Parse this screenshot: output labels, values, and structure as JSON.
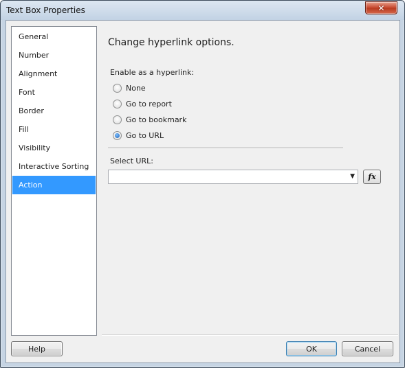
{
  "window": {
    "title": "Text Box Properties",
    "close_symbol": "✕"
  },
  "sidebar": {
    "items": [
      {
        "label": "General",
        "selected": false
      },
      {
        "label": "Number",
        "selected": false
      },
      {
        "label": "Alignment",
        "selected": false
      },
      {
        "label": "Font",
        "selected": false
      },
      {
        "label": "Border",
        "selected": false
      },
      {
        "label": "Fill",
        "selected": false
      },
      {
        "label": "Visibility",
        "selected": false
      },
      {
        "label": "Interactive Sorting",
        "selected": false
      },
      {
        "label": "Action",
        "selected": true
      }
    ]
  },
  "main": {
    "heading": "Change hyperlink options.",
    "group_label": "Enable as a hyperlink:",
    "options": [
      {
        "label": "None",
        "checked": false
      },
      {
        "label": "Go to report",
        "checked": false
      },
      {
        "label": "Go to bookmark",
        "checked": false
      },
      {
        "label": "Go to URL",
        "checked": true
      }
    ],
    "url_label": "Select URL:",
    "url_value": "",
    "fx_label": "fx"
  },
  "footer": {
    "help_label": "Help",
    "ok_label": "OK",
    "cancel_label": "Cancel"
  },
  "colors": {
    "selection": "#3399ff",
    "close_button": "#c7462d"
  },
  "icons": {
    "close": "close-icon",
    "combo_arrow": "chevron-down-icon",
    "expression": "function-icon"
  }
}
